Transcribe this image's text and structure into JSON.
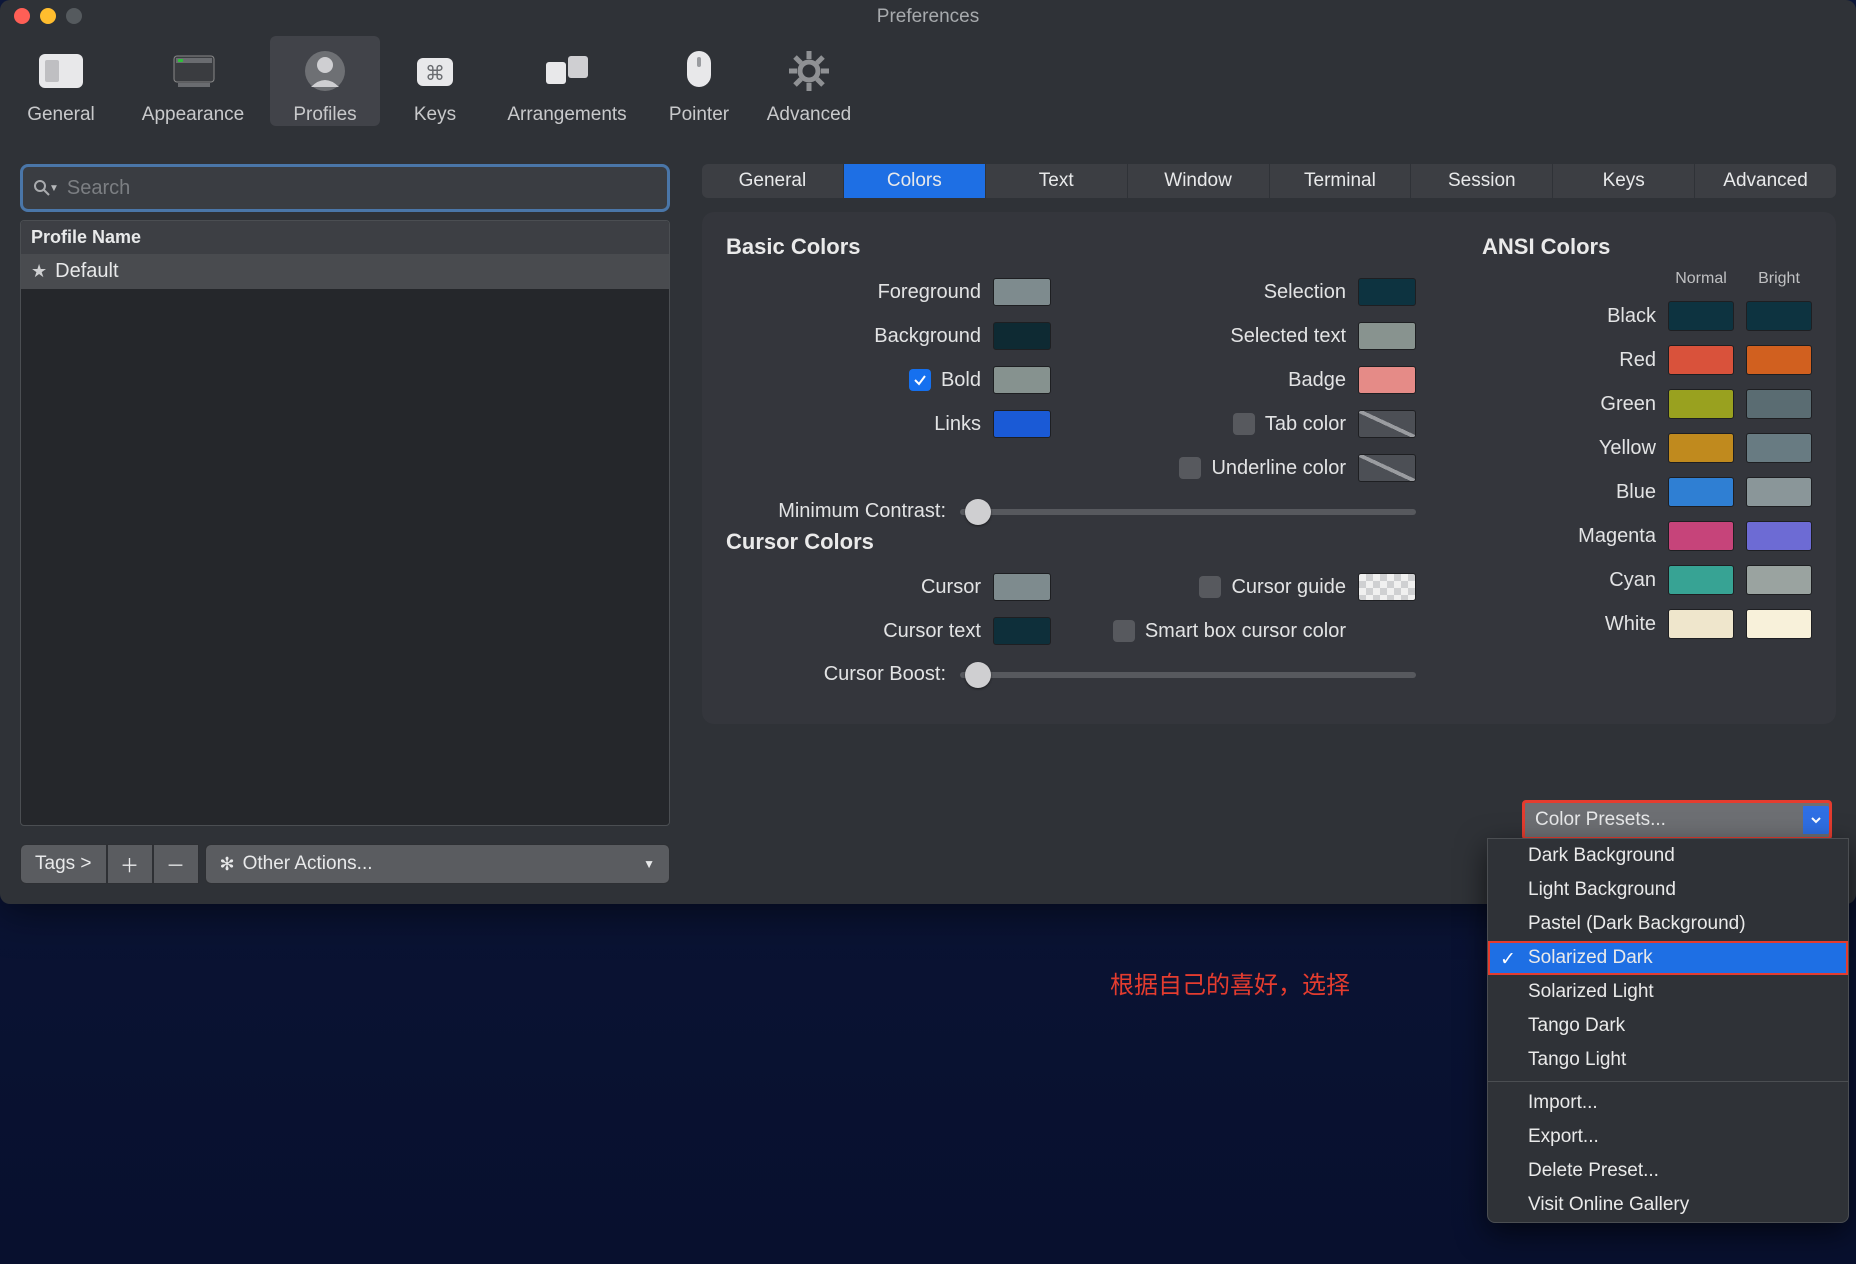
{
  "window": {
    "title": "Preferences"
  },
  "toolbar": {
    "items": [
      {
        "key": "general",
        "label": "General"
      },
      {
        "key": "appearance",
        "label": "Appearance"
      },
      {
        "key": "profiles",
        "label": "Profiles"
      },
      {
        "key": "keys",
        "label": "Keys"
      },
      {
        "key": "arrangements",
        "label": "Arrangements"
      },
      {
        "key": "pointer",
        "label": "Pointer"
      },
      {
        "key": "advanced",
        "label": "Advanced"
      }
    ],
    "active": "profiles"
  },
  "sidebar": {
    "search_placeholder": "Search",
    "header": "Profile Name",
    "items": [
      {
        "name": "Default",
        "starred": true
      }
    ],
    "tags_label": "Tags >",
    "other_actions": "Other Actions..."
  },
  "subtabs": {
    "items": [
      "General",
      "Colors",
      "Text",
      "Window",
      "Terminal",
      "Session",
      "Keys",
      "Advanced"
    ],
    "active": "Colors"
  },
  "basic": {
    "title": "Basic Colors",
    "rows": [
      {
        "label": "Foreground",
        "color": "#7e8b8e"
      },
      {
        "label": "Background",
        "color": "#0e2a33"
      },
      {
        "label": "Bold",
        "checkbox": true,
        "checked": true,
        "color": "#86928f"
      },
      {
        "label": "Links",
        "color": "#1a5ad6"
      }
    ],
    "rows_right": [
      {
        "label": "Selection",
        "color": "#0d3340"
      },
      {
        "label": "Selected text",
        "color": "#88938f"
      },
      {
        "label": "Badge",
        "color": "#e58b87"
      },
      {
        "label": "Tab color",
        "checkbox": true,
        "checked": false,
        "diag": true
      },
      {
        "label": "Underline color",
        "checkbox": true,
        "checked": false,
        "diag": true
      }
    ],
    "min_contrast": "Minimum Contrast:"
  },
  "cursor": {
    "title": "Cursor Colors",
    "rows": [
      {
        "label": "Cursor",
        "color": "#7e8b8e"
      },
      {
        "label": "Cursor text",
        "color": "#0e2f3a"
      }
    ],
    "rows_right": [
      {
        "label": "Cursor guide",
        "checkbox": true,
        "checked": false,
        "checker": true
      },
      {
        "label": "Smart box cursor color",
        "checkbox": true,
        "checked": false,
        "noswatch": true
      }
    ],
    "boost": "Cursor Boost:"
  },
  "ansi": {
    "title": "ANSI Colors",
    "col_normal": "Normal",
    "col_bright": "Bright",
    "rows": [
      {
        "label": "Black",
        "n": "#0d3340",
        "b": "#0d3340"
      },
      {
        "label": "Red",
        "n": "#d9523b",
        "b": "#d1601f"
      },
      {
        "label": "Green",
        "n": "#99a11f",
        "b": "#5a6c72"
      },
      {
        "label": "Yellow",
        "n": "#c08a1e",
        "b": "#687b82"
      },
      {
        "label": "Blue",
        "n": "#2f7fd3",
        "b": "#8a9699"
      },
      {
        "label": "Magenta",
        "n": "#c6447a",
        "b": "#6d6bd4"
      },
      {
        "label": "Cyan",
        "n": "#37a394",
        "b": "#9aa3a0"
      },
      {
        "label": "White",
        "n": "#efe6cc",
        "b": "#f8f1da"
      }
    ]
  },
  "presets": {
    "button": "Color Presets...",
    "menu": [
      "Dark Background",
      "Light Background",
      "Pastel (Dark Background)",
      "Solarized Dark",
      "Solarized Light",
      "Tango Dark",
      "Tango Light"
    ],
    "menu2": [
      "Import...",
      "Export...",
      "Delete Preset...",
      "Visit Online Gallery"
    ],
    "selected": "Solarized Dark"
  },
  "annotation": "根据自己的喜好，选择"
}
